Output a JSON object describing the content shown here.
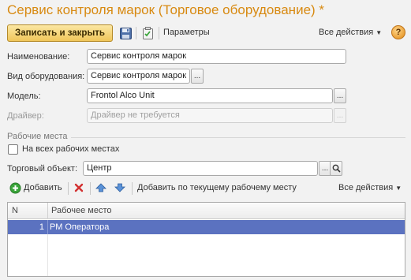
{
  "window": {
    "title": "Сервис контроля марок (Торговое оборудование) *"
  },
  "toolbar": {
    "save_close_label": "Записать и закрыть",
    "params_label": "Параметры",
    "all_actions_label": "Все действия",
    "help_label": "?"
  },
  "form": {
    "name": {
      "label": "Наименование:",
      "value": "Сервис контроля марок"
    },
    "equipment_type": {
      "label": "Вид оборудования:",
      "value": "Сервис контроля марок",
      "button": "..."
    },
    "model": {
      "label": "Модель:",
      "value": "Frontol Alco Unit",
      "button": "..."
    },
    "driver": {
      "label": "Драйвер:",
      "placeholder": "Драйвер не требуется",
      "button": "..."
    }
  },
  "workplaces": {
    "section_title": "Рабочие места",
    "all_workplaces_label": "На всех рабочих местах",
    "all_workplaces_checked": false,
    "trade_object": {
      "label": "Торговый объект:",
      "value": "Центр",
      "button": "..."
    },
    "table_toolbar": {
      "add_label": "Добавить",
      "add_current_label": "Добавить по текущему рабочему месту",
      "all_actions_label": "Все действия"
    },
    "table": {
      "columns": [
        "N",
        "Рабочее место"
      ],
      "rows": [
        {
          "n": "1",
          "place": "РМ Оператора",
          "selected": true
        }
      ]
    }
  },
  "colors": {
    "title": "#d88a12",
    "primary_button": "#f0c65a",
    "selection": "#5b72c0",
    "add_icon": "#3aa53a",
    "delete_icon": "#d23030",
    "arrow_icon": "#3a78c8"
  }
}
